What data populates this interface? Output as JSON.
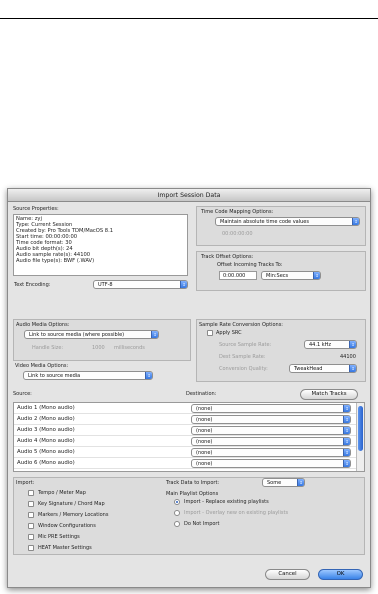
{
  "dialog": {
    "title": "Import Session Data"
  },
  "source_props": {
    "label": "Source Properties:",
    "lines": [
      "Name: zyj",
      "Type: Current Session",
      "Created by: Pro Tools TDM/MacOS 8.1",
      "Start time: 00:00:00:00",
      "Time code format: 30",
      "Audio bit depth(s): 24",
      "Audio sample rate(s): 44100",
      "Audio file type(s): BWF (.WAV)"
    ]
  },
  "text_encoding": {
    "label": "Text Encoding:",
    "value": "UTF-8"
  },
  "timecode": {
    "label": "Time Code Mapping Options:",
    "value": "Maintain absolute time code values",
    "time": "00:00:00:00"
  },
  "track_offset": {
    "label": "Track Offset Options:",
    "offset_label": "Offset Incoming Tracks To:",
    "value": "0:00.000",
    "unit": "Min:Secs"
  },
  "audio_media": {
    "label": "Audio Media Options:",
    "value": "Link to source media (where possible)",
    "handle_label": "Handle Size:",
    "handle_value": "1000",
    "handle_unit": "milliseconds"
  },
  "video_media": {
    "label": "Video Media Options:",
    "value": "Link to source media"
  },
  "src": {
    "label": "Sample Rate Conversion Options:",
    "apply": "Apply SRC",
    "source_rate_label": "Source Sample Rate:",
    "source_rate_value": "44.1 kHz",
    "dest_rate_label": "Dest Sample Rate:",
    "dest_rate_value": "44100",
    "quality_label": "Conversion Quality:",
    "quality_value": "TweakHead"
  },
  "tracks": {
    "source_header": "Source:",
    "dest_header": "Destination:",
    "match_button": "Match Tracks",
    "rows": [
      {
        "source": "Audio 1 (Mono audio)",
        "dest": "(none)"
      },
      {
        "source": "Audio 2 (Mono audio)",
        "dest": "(none)"
      },
      {
        "source": "Audio 3 (Mono audio)",
        "dest": "(none)"
      },
      {
        "source": "Audio 4 (Mono audio)",
        "dest": "(none)"
      },
      {
        "source": "Audio 5 (Mono audio)",
        "dest": "(none)"
      },
      {
        "source": "Audio 6 (Mono audio)",
        "dest": "(none)"
      }
    ]
  },
  "import_opts": {
    "label": "Import:",
    "items": [
      "Tempo / Meter Map",
      "Key Signature / Chord Map",
      "Markers / Memory Locations",
      "Window Configurations",
      "Mic PRE Settings",
      "HEAT Master Settings"
    ]
  },
  "track_data": {
    "label": "Track Data to Import:",
    "value": "Some"
  },
  "playlist": {
    "label": "Main Playlist Options",
    "options": [
      "Import - Replace existing playlists",
      "Import - Overlay new on existing playlists",
      "Do Not Import"
    ]
  },
  "buttons": {
    "cancel": "Cancel",
    "ok": "OK"
  }
}
